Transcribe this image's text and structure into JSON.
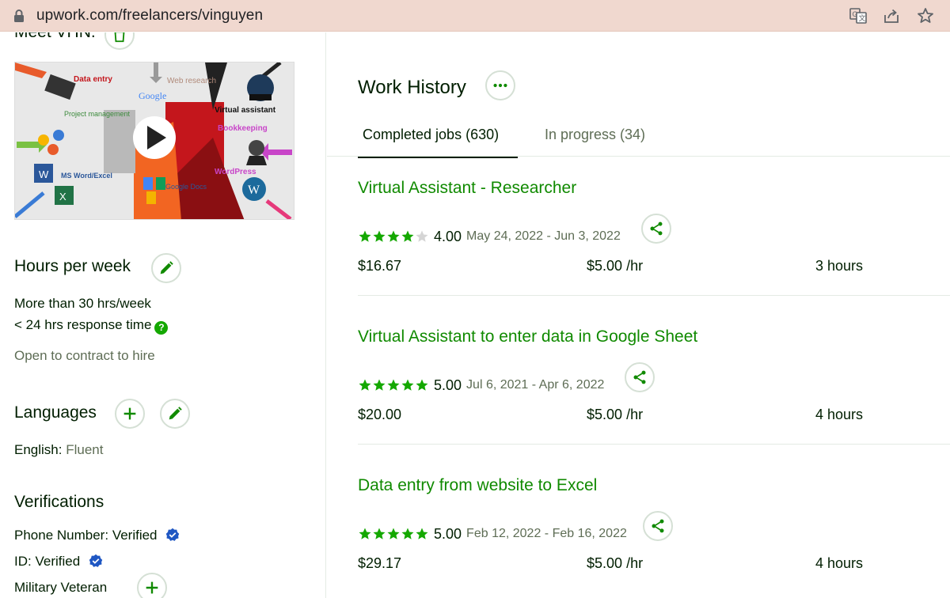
{
  "browser": {
    "url": "upwork.com/freelancers/vinguyen"
  },
  "sidebar": {
    "partial_title": "Meet VHN.",
    "video_labels": {
      "data_entry": "Data entry",
      "web_research": "Web research",
      "google": "Google",
      "project_management": "Project management",
      "virtual_assistant": "Virtual assistant",
      "bookkeeping": "Bookkeeping",
      "ms_word_excel": "MS Word/Excel",
      "wordpress": "WordPress",
      "google_docs": "Google Docs"
    },
    "hours": {
      "title": "Hours per week",
      "availability": "More than 30 hrs/week",
      "response": "< 24 hrs response time",
      "contract": "Open to contract to hire"
    },
    "languages": {
      "title": "Languages",
      "language": "English:",
      "level": "Fluent"
    },
    "verifications": {
      "title": "Verifications",
      "phone_label": "Phone Number:",
      "phone_value": "Verified",
      "id_label": "ID:",
      "id_value": "Verified",
      "military": "Military Veteran"
    }
  },
  "work_history": {
    "title": "Work History",
    "tabs": [
      {
        "label": "Completed jobs (630)",
        "active": true
      },
      {
        "label": "In progress (34)",
        "active": false
      }
    ],
    "jobs": [
      {
        "title": "Virtual Assistant - Researcher",
        "stars": 4,
        "rating": "4.00",
        "dates": "May 24, 2022 - Jun 3, 2022",
        "earned": "$16.67",
        "rate": "$5.00",
        "rate_unit": "/hr",
        "hours": "3 hours"
      },
      {
        "title": "Virtual Assistant to enter data in Google Sheet",
        "stars": 5,
        "rating": "5.00",
        "dates": "Jul 6, 2021 - Apr 6, 2022",
        "earned": "$20.00",
        "rate": "$5.00",
        "rate_unit": "/hr",
        "hours": "4 hours"
      },
      {
        "title": "Data entry from website to Excel",
        "stars": 5,
        "rating": "5.00",
        "dates": "Feb 12, 2022 - Feb 16, 2022",
        "earned": "$29.17",
        "rate": "$5.00",
        "rate_unit": "/hr",
        "hours": "4 hours"
      }
    ]
  },
  "colors": {
    "accent_green": "#108a00",
    "star_green": "#14a800",
    "verified_blue": "#1f57c3",
    "url_bar": "#f0d8cf"
  },
  "icons": [
    "lock-icon",
    "translate-icon",
    "share-page-icon",
    "bookmark-star-icon",
    "trash-icon",
    "play-icon",
    "edit-pencil-icon",
    "plus-icon",
    "help-icon",
    "verified-badge-icon",
    "more-options-icon",
    "share-icon",
    "star-icon"
  ]
}
